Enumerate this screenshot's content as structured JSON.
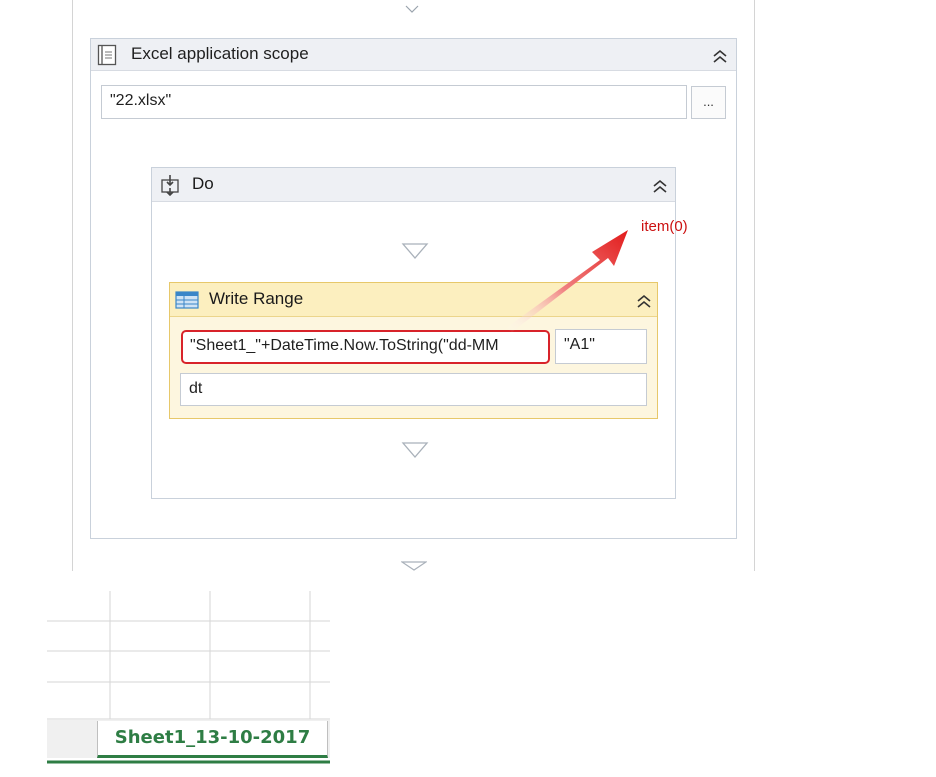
{
  "excel_scope": {
    "title": "Excel application scope",
    "workbook_path": "\"22.xlsx\"",
    "browse_label": "..."
  },
  "do_sequence": {
    "title": "Do"
  },
  "write_range": {
    "title": "Write Range",
    "sheet_name_value": "\"Sheet1_\"+DateTime.Now.ToString(\"dd-MM",
    "cell_value": "\"A1\"",
    "datatable_value": "dt"
  },
  "annotation": {
    "text": "item(0)",
    "color": "#cc1111"
  },
  "excel_sheet": {
    "tab_label": "Sheet1_13-10-2017",
    "tab_color": "#2e7d44"
  }
}
